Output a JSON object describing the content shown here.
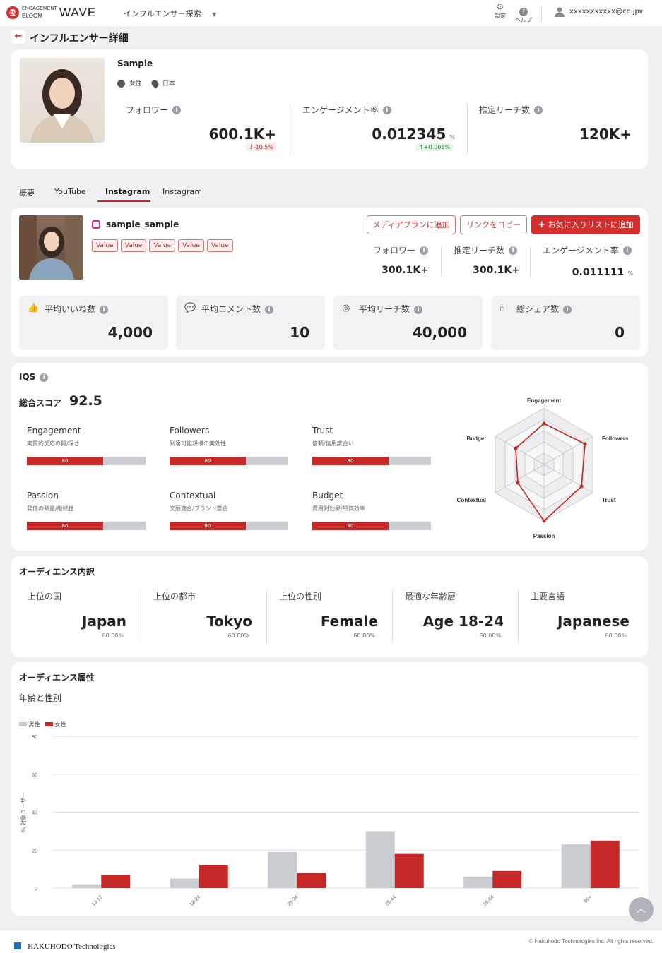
{
  "header": {
    "logo_top": "ENGAGEMENT",
    "logo_bottom": "BLOOM",
    "logo_wave": "WAVE",
    "nav_label": "インフルエンサー探索",
    "settings_label": "設定",
    "help_label": "ヘルプ",
    "user_email": "xxxxxxxxxxx@co.jp"
  },
  "page": {
    "title": "インフルエンサー詳細"
  },
  "profile": {
    "name": "Sample",
    "gender": "女性",
    "country": "日本",
    "followers_label": "フォロワー",
    "followers_value": "600.1K+",
    "followers_change": "-10.5%",
    "engagement_label": "エンゲージメント率",
    "engagement_value": "0.012345",
    "engagement_unit": "%",
    "engagement_change": "+0.001%",
    "reach_label": "推定リーチ数",
    "reach_value": "120K+"
  },
  "tabs": [
    {
      "label": "概要"
    },
    {
      "label": "YouTube"
    },
    {
      "label": "Instagram",
      "active": true
    },
    {
      "label": "Instagram"
    }
  ],
  "account": {
    "handle": "sample_sample",
    "tags": [
      "Value",
      "Value",
      "Value",
      "Value",
      "Value"
    ],
    "btn_media": "メディアプランに追加",
    "btn_copy": "リンクをコピー",
    "btn_fav": "お気に入りリストに追加",
    "followers_label": "フォロワー",
    "followers_value": "300.1K+",
    "reach_label": "推定リーチ数",
    "reach_value": "300.1K+",
    "eng_label": "エンゲージメント率",
    "eng_value": "0.011111",
    "eng_unit": "%"
  },
  "stats": [
    {
      "label": "平均いいね数",
      "value": "4,000",
      "icon": "thumbs-up-icon"
    },
    {
      "label": "平均コメント数",
      "value": "10",
      "icon": "comment-icon"
    },
    {
      "label": "平均リーチ数",
      "value": "40,000",
      "icon": "target-icon"
    },
    {
      "label": "総シェア数",
      "value": "0",
      "icon": "share-icon"
    }
  ],
  "iqs": {
    "title": "IQS",
    "total_label": "総合スコア",
    "total_value": "92.5",
    "metrics": [
      {
        "name": "Engagement",
        "sub": "実質的反応の質/深さ",
        "score": "80"
      },
      {
        "name": "Followers",
        "sub": "到達可能規模の実効性",
        "score": "80"
      },
      {
        "name": "Trust",
        "sub": "信頼/信用度合い",
        "score": "80"
      },
      {
        "name": "Passion",
        "sub": "発信の熱量/継続性",
        "score": "80"
      },
      {
        "name": "Contextual",
        "sub": "文脈適合/ブランド整合",
        "score": "80"
      },
      {
        "name": "Budget",
        "sub": "費用対効果/単価効率",
        "score": "80"
      }
    ],
    "radar_labels": [
      "Engagement",
      "Followers",
      "Trust",
      "Passion",
      "Contextual",
      "Budget"
    ]
  },
  "audience": {
    "title": "オーディエンス内訳",
    "items": [
      {
        "label": "上位の国",
        "value": "Japan",
        "pct": "60.00%"
      },
      {
        "label": "上位の都市",
        "value": "Tokyo",
        "pct": "60.00%"
      },
      {
        "label": "上位の性別",
        "value": "Female",
        "pct": "60.00%"
      },
      {
        "label": "最適な年齢層",
        "value": "Age 18-24",
        "pct": "60.00%"
      },
      {
        "label": "主要言語",
        "value": "Japanese",
        "pct": "60.00%"
      }
    ]
  },
  "attributes": {
    "title": "オーディエンス属性",
    "subtitle": "年齢と性別"
  },
  "chart_data": {
    "type": "bar",
    "categories": [
      "13-17",
      "18-24",
      "25-34",
      "35-44",
      "55-64",
      "65+"
    ],
    "series": [
      {
        "name": "男性",
        "values": [
          2,
          5,
          19,
          30,
          6,
          23
        ],
        "color": "#c9ccd1"
      },
      {
        "name": "女性",
        "values": [
          7,
          12,
          8,
          18,
          9,
          25
        ],
        "color": "#c62828"
      }
    ],
    "yticks": [
      "80",
      "60",
      "40",
      "20",
      "0"
    ],
    "ylabel": "% 対象ユーザー",
    "ylim": [
      0,
      80
    ],
    "legend": "top-left"
  },
  "footer": {
    "company": "HAKUHODO Technologies",
    "copyright": "© Hakuhodo Technologies Inc. All rights reserved."
  }
}
